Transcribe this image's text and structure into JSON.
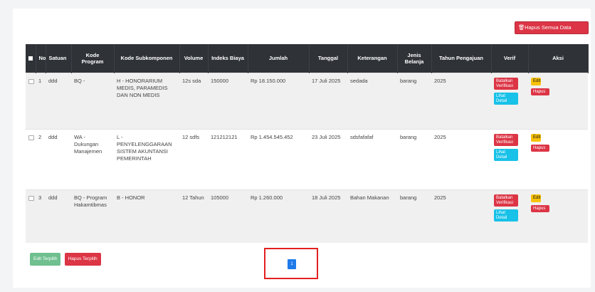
{
  "toolbar": {
    "delete_all_label": "Hapus Semua Data",
    "delete_all_icon": "trash-icon"
  },
  "table": {
    "headers": [
      "No",
      "Satuan",
      "Kode Program",
      "Kode Subkomponen",
      "Volume",
      "Indeks Biaya",
      "Jumlah",
      "Tanggal",
      "Keterangan",
      "Jenis Belanja",
      "Tahun Pengajuan",
      "Verif",
      "Aksi"
    ],
    "rows": [
      {
        "no": "1",
        "satuan": "ddd",
        "kode_program": "BQ -",
        "kode_subkomponen": "H - HONORARIUM MEDIS, PARAMEDIS DAN NON MEDIS",
        "volume": "12s sda",
        "indeks_biaya": "150000",
        "jumlah": "Rp 18.150.000",
        "tanggal": "17 Juli 2025",
        "keterangan": "sedada",
        "jenis_belanja": "barang",
        "tahun": "2025"
      },
      {
        "no": "2",
        "satuan": "ddd",
        "kode_program": "WA - Dukungan Manajemen",
        "kode_subkomponen": "L - PENYELENGGARAAN SISTEM AKUNTANSI PEMERINTAH",
        "volume": "12 sdfs",
        "indeks_biaya": "121212121",
        "jumlah": "Rp 1.454.545.452",
        "tanggal": "23 Juli 2025",
        "keterangan": "sdsfafafaf",
        "jenis_belanja": "barang",
        "tahun": "2025"
      },
      {
        "no": "3",
        "satuan": "ddd",
        "kode_program": "BQ - Program Hakamtibmas",
        "kode_subkomponen": "B - HONOR",
        "volume": "12 Tahun",
        "indeks_biaya": "105000",
        "jumlah": "Rp 1.260.000",
        "tanggal": "18 Juli 2025",
        "keterangan": "Bahan Makanan",
        "jenis_belanja": "barang",
        "tahun": "2025"
      }
    ],
    "verif_labels": {
      "reject": "Batalkan Verifikasi",
      "detail": "Lihat Detail"
    },
    "aksi_labels": {
      "edit": "Edit",
      "delete": "Hapus"
    }
  },
  "bottom": {
    "edit_selected": "Edit Terpilih",
    "delete_selected": "Hapus Terpilih"
  },
  "pagination": {
    "current_page": "1"
  },
  "colors": {
    "header_bg": "#2f3237",
    "danger": "#dc3545",
    "info": "#17c1e8",
    "warning": "#f8c20a",
    "success": "#6fbf8f",
    "primary": "#1f7aea",
    "highlight": "#e32020"
  }
}
